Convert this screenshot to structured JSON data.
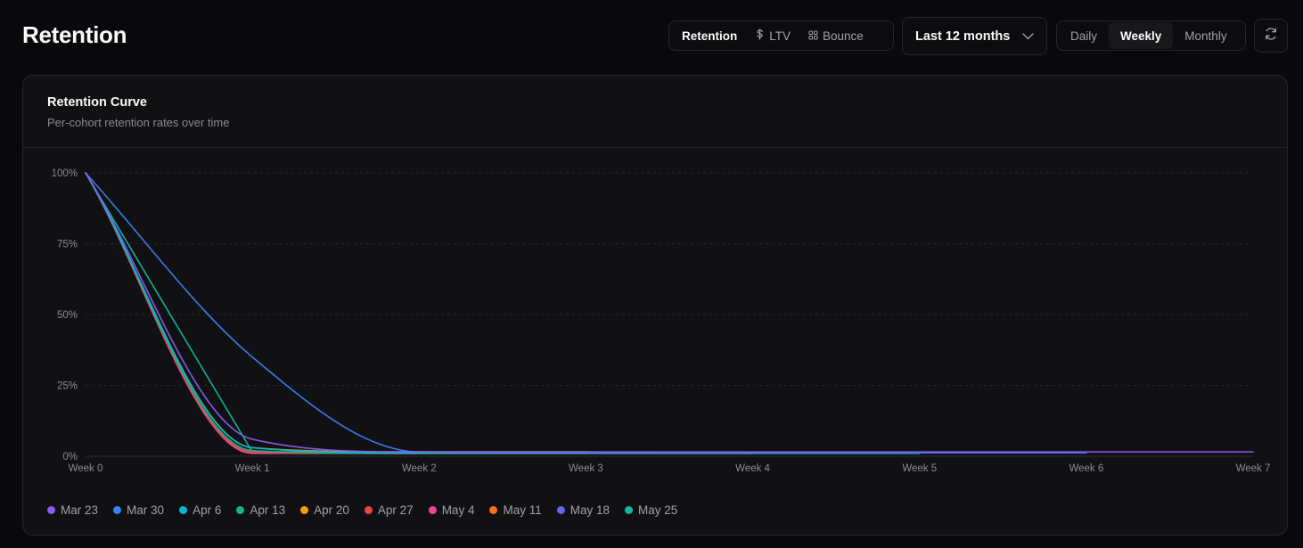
{
  "header": {
    "title": "Retention",
    "metric_tabs": [
      {
        "label": "Retention",
        "icon": "",
        "active": true
      },
      {
        "label": "LTV",
        "icon": "dollar-icon",
        "active": false
      },
      {
        "label": "Bounce",
        "icon": "grid-icon",
        "active": false
      }
    ],
    "range": {
      "label": "Last 12 months",
      "icon": "chevron-down-icon"
    },
    "period_tabs": [
      {
        "label": "Daily",
        "active": false
      },
      {
        "label": "Weekly",
        "active": true
      },
      {
        "label": "Monthly",
        "active": false
      }
    ],
    "refresh_icon": "refresh-icon"
  },
  "card": {
    "title": "Retention Curve",
    "subtitle": "Per-cohort retention rates over time"
  },
  "chart_data": {
    "type": "line",
    "x": [
      "Week 0",
      "Week 1",
      "Week 2",
      "Week 3",
      "Week 4",
      "Week 5",
      "Week 6",
      "Week 7"
    ],
    "ylim": [
      0,
      100
    ],
    "yticks": [
      "0%",
      "25%",
      "50%",
      "75%",
      "100%"
    ],
    "grid": true,
    "legend": "bottom-left",
    "series": [
      {
        "name": "Mar 23",
        "color": "#8b5cf6",
        "values": [
          100,
          6,
          1.5,
          1.5,
          1.5,
          1.5,
          1.5,
          1.5
        ]
      },
      {
        "name": "Mar 30",
        "color": "#3b82f6",
        "values": [
          100,
          35,
          1.5,
          1.2,
          1.2,
          1.2,
          1.2
        ]
      },
      {
        "name": "Apr 6",
        "color": "#06b6d4",
        "values": [
          100,
          3,
          1.2,
          1.2,
          1.2,
          1.2
        ]
      },
      {
        "name": "Apr 13",
        "color": "#10b981",
        "values": [
          100,
          2,
          1,
          1,
          1,
          1
        ]
      },
      {
        "name": "Apr 20",
        "color": "#f59e0b",
        "values": [
          100,
          3,
          1.5,
          1.5,
          1
        ]
      },
      {
        "name": "Apr 27",
        "color": "#ef4444",
        "values": [
          100,
          1.5,
          1,
          1,
          1
        ]
      },
      {
        "name": "May 4",
        "color": "#ec4899",
        "values": [
          100,
          1,
          1,
          1
        ]
      },
      {
        "name": "May 11",
        "color": "#f97316",
        "values": [
          100,
          1.5,
          1.5,
          1.5
        ]
      },
      {
        "name": "May 18",
        "color": "#6366f1",
        "values": [
          100,
          1.5,
          1
        ]
      },
      {
        "name": "May 25",
        "color": "#14b8a6",
        "values": [
          100,
          1.5
        ]
      }
    ]
  }
}
